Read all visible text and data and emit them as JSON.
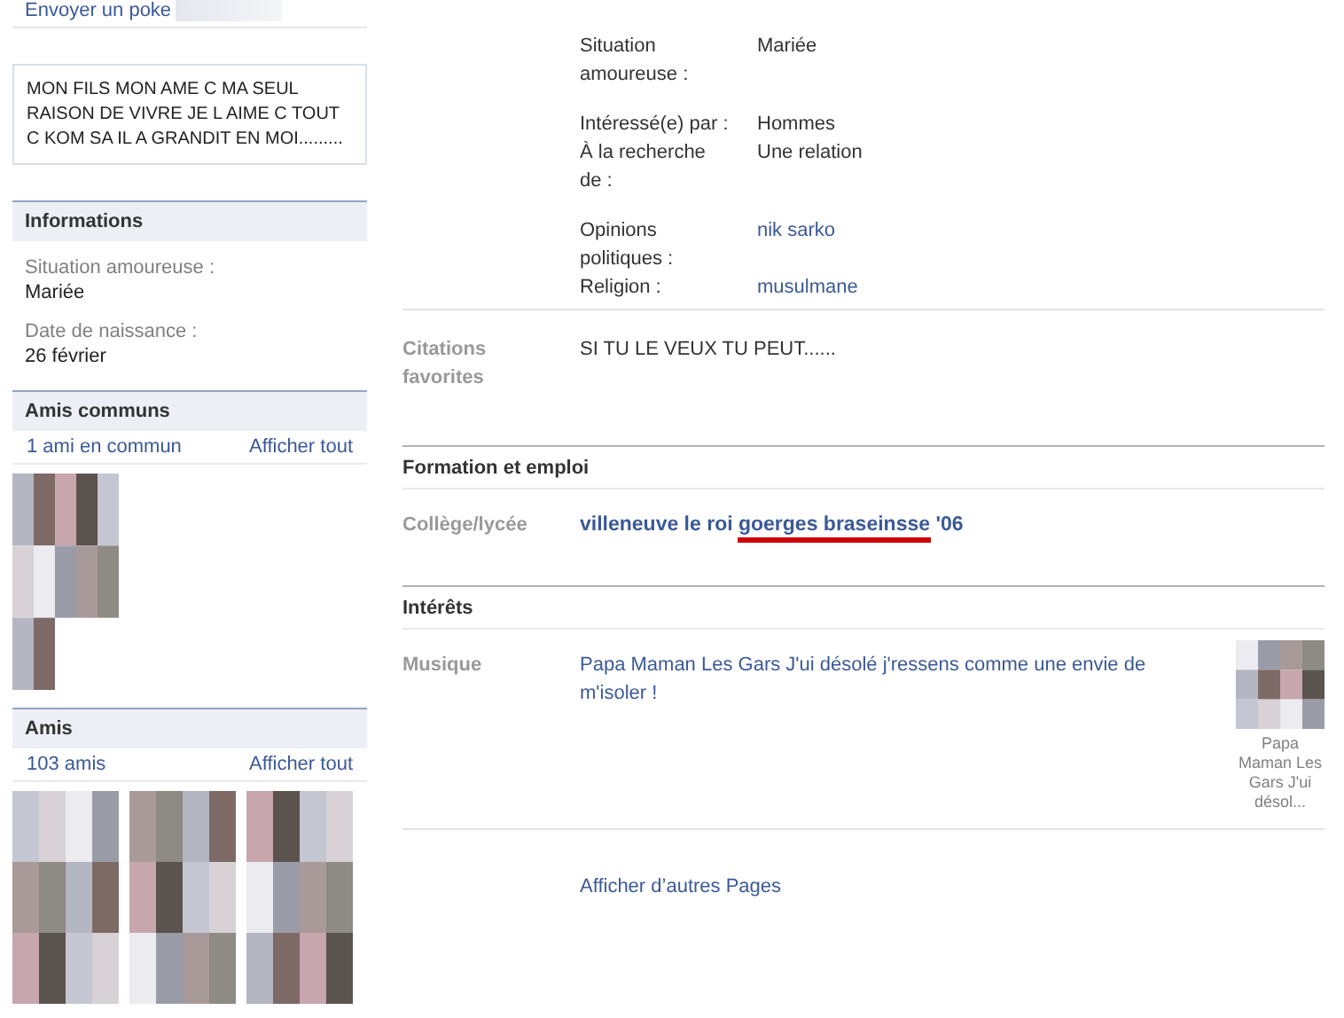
{
  "sidebar": {
    "poke_link": "Envoyer un poke",
    "quote": "MON FILS MON AME C MA SEUL RAISON DE VIVRE JE L AIME C TOUT C KOM SA IL A GRANDIT EN MOI.........",
    "informations": {
      "title": "Informations",
      "fields": [
        {
          "label": "Situation amoureuse :",
          "value": "Mariée"
        },
        {
          "label": "Date de naissance :",
          "value": "26 février"
        }
      ]
    },
    "mutual_friends": {
      "title": "Amis communs",
      "count": "1 ami en commun",
      "see_all": "Afficher tout"
    },
    "friends": {
      "title": "Amis",
      "count": "103 amis",
      "see_all": "Afficher tout"
    }
  },
  "main": {
    "basic_info": [
      {
        "label": "Situation amoureuse :",
        "value": "Mariée",
        "link": false
      },
      {
        "label": "Intéressé(e) par :",
        "value": "Hommes",
        "link": false
      },
      {
        "label": "À la recherche de :",
        "value": "Une relation",
        "link": false
      },
      {
        "label": "Opinions politiques :",
        "value": "nik sarko",
        "link": true
      },
      {
        "label": "Religion :",
        "value": "musulmane",
        "link": true
      }
    ],
    "quotes": {
      "label": "Citations favorites",
      "value": "SI TU LE VEUX TU PEUT......"
    },
    "education": {
      "title": "Formation et emploi",
      "label": "Collège/lycée",
      "school_start": "villeneuve le roi ",
      "school_underlined": "goerges braseinsse",
      "school_end": " '06"
    },
    "interests": {
      "title": "Intérêts",
      "label": "Musique",
      "value": "Papa Maman Les Gars J'ui désolé j'ressens comme une envie de m'isoler !",
      "thumb_caption": "Papa Maman Les Gars J'ui désol..."
    },
    "more_pages": "Afficher d’autres Pages"
  }
}
